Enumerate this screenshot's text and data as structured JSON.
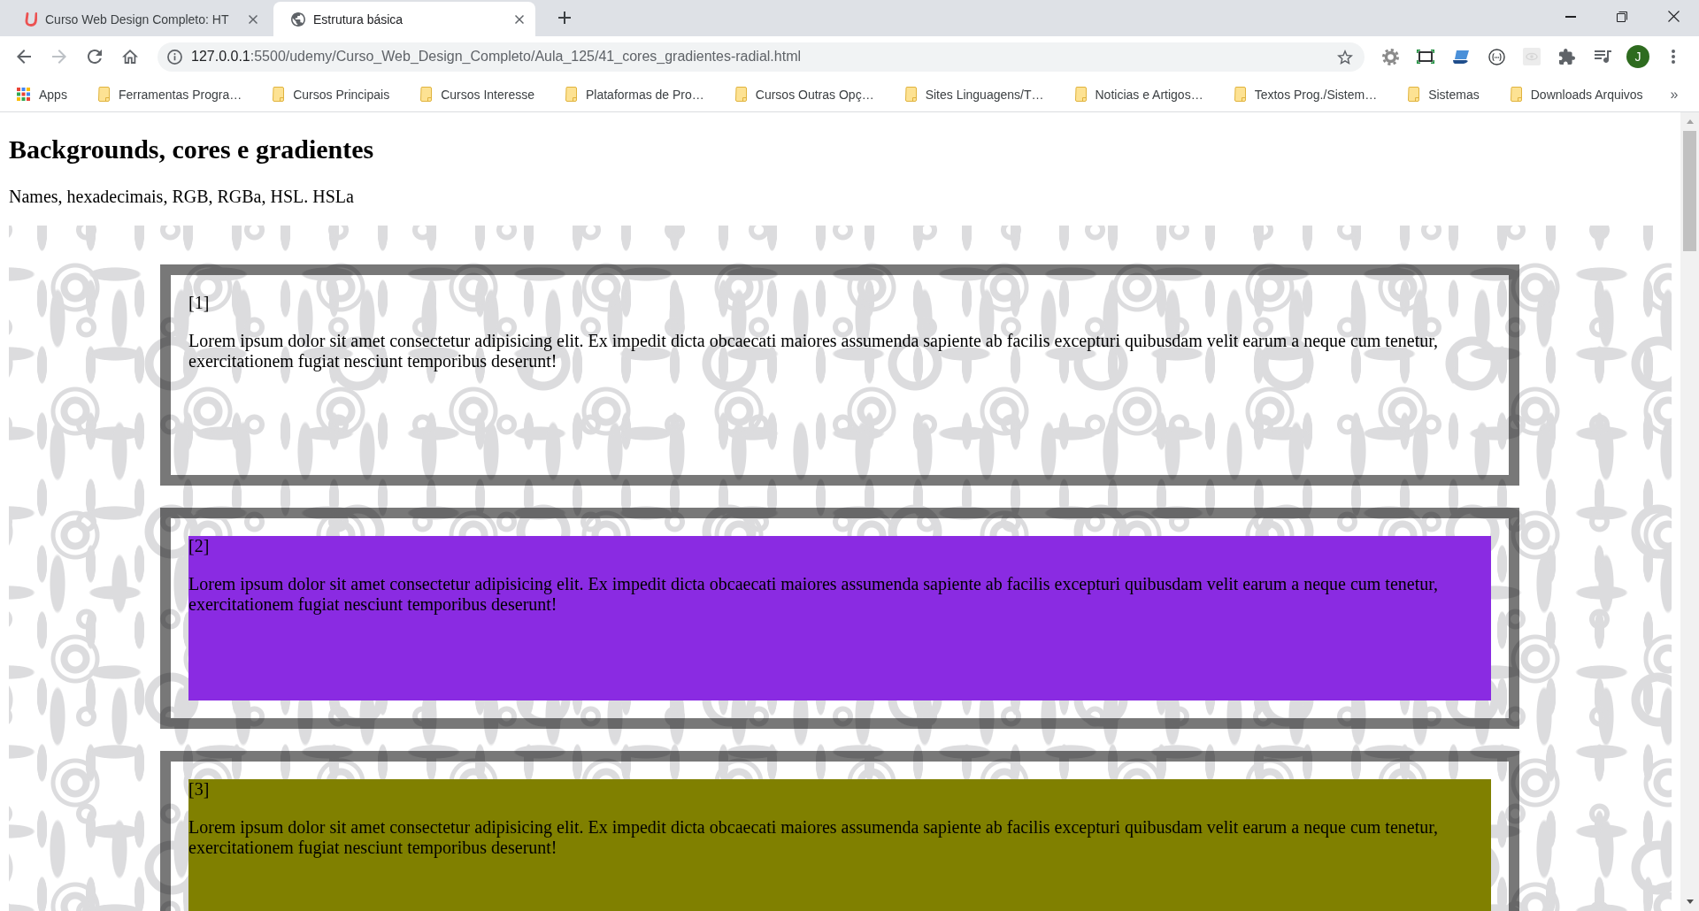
{
  "browser": {
    "tabs": [
      {
        "kind": "logo",
        "title": "Curso Web Design Completo: HT",
        "selected": false
      },
      {
        "kind": "globe",
        "title": "Estrutura básica",
        "selected": true
      }
    ],
    "navigation": {
      "back": {
        "disabled": false
      },
      "forward": {
        "disabled": true
      }
    },
    "address_bar": {
      "host": "127.0.0.1",
      "path": ":5500/udemy/Curso_Web_Design_Completo/Aula_125/41_cores_gradientes-radial.html",
      "bookmarked": false
    },
    "profile_initial": "J",
    "bookmarks": [
      {
        "kind": "apps",
        "label": "Apps"
      },
      {
        "kind": "folder",
        "label": "Ferramentas Progra…"
      },
      {
        "kind": "folder",
        "label": "Cursos Principais"
      },
      {
        "kind": "folder",
        "label": "Cursos Interesse"
      },
      {
        "kind": "folder",
        "label": "Plataformas de Pro…"
      },
      {
        "kind": "folder",
        "label": "Cursos Outras Opç…"
      },
      {
        "kind": "folder",
        "label": "Sites Linguagens/T…"
      },
      {
        "kind": "folder",
        "label": "Noticias e Artigos…"
      },
      {
        "kind": "folder",
        "label": "Textos Prog./Sistem…"
      },
      {
        "kind": "folder",
        "label": "Sistemas"
      },
      {
        "kind": "folder",
        "label": "Downloads Arquivos"
      }
    ],
    "bookmarks_overflow": "»"
  },
  "page": {
    "heading": "Backgrounds, cores e gradientes",
    "subtitle": "Names, hexadecimais, RGB, RGBa, HSL. HSLa",
    "boxes": [
      {
        "number": "[1]",
        "text": "Lorem ipsum dolor sit amet consectetur adipisicing elit. Ex impedit dicta obcaecati maiores assumenda sapiente ab facilis excepturi quibusdam velit earum a neque cum tenetur, exercitationem fugiat nesciunt temporibus deserunt!"
      },
      {
        "number": "[2]",
        "text": "Lorem ipsum dolor sit amet consectetur adipisicing elit. Ex impedit dicta obcaecati maiores assumenda sapiente ab facilis excepturi quibusdam velit earum a neque cum tenetur, exercitationem fugiat nesciunt temporibus deserunt!",
        "color": "#8a2be2"
      },
      {
        "number": "[3]",
        "text": "Lorem ipsum dolor sit amet consectetur adipisicing elit. Ex impedit dicta obcaecati maiores assumenda sapiente ab facilis excepturi quibusdam velit earum a neque cum tenetur, exercitationem fugiat nesciunt temporibus deserunt!",
        "color": "#808000"
      }
    ]
  }
}
